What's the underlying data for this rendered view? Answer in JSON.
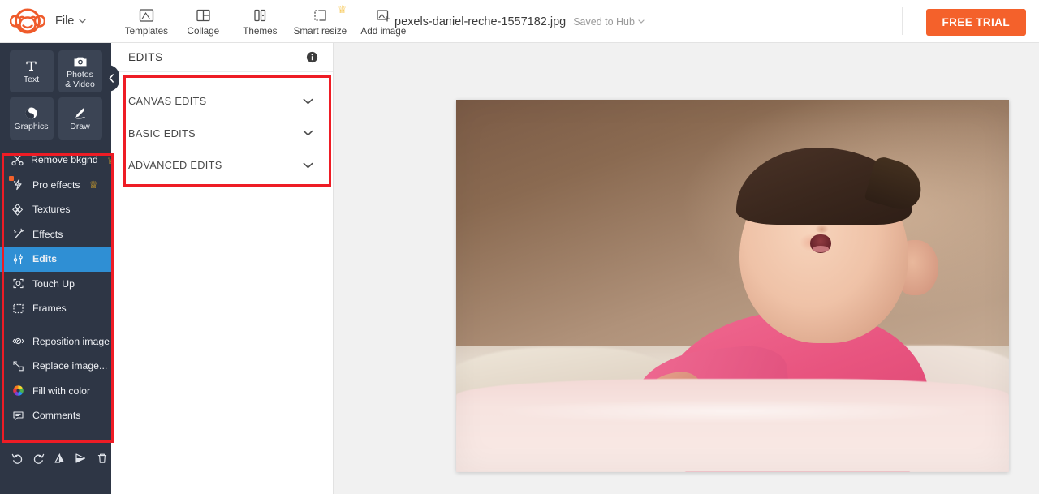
{
  "app": {
    "name": "PicMonkey",
    "logo_icon": "monkey-logo-icon",
    "accent_color": "#f4612b",
    "sidebar_color": "#2e3645",
    "highlight_color": "#2f8fd4",
    "annotation_color": "#ee1c25"
  },
  "topbar": {
    "file_menu": {
      "label": "File",
      "icon": "chevron-down-icon"
    },
    "tools": [
      {
        "label": "Templates",
        "icon": "templates-icon",
        "pro": false
      },
      {
        "label": "Collage",
        "icon": "collage-icon",
        "pro": false
      },
      {
        "label": "Themes",
        "icon": "themes-icon",
        "pro": false
      },
      {
        "label": "Smart resize",
        "icon": "smart-resize-icon",
        "pro": true,
        "pro_icon": "crown-icon"
      },
      {
        "label": "Add image",
        "icon": "add-image-icon",
        "pro": false
      }
    ],
    "document": {
      "title": "pexels-daniel-reche-1557182.jpg",
      "save_status": "Saved to Hub",
      "save_status_icon": "chevron-down-icon"
    },
    "free_trial_button": "FREE TRIAL"
  },
  "sidebar": {
    "quick_tools": [
      {
        "label": "Text",
        "icon": "text-t-icon"
      },
      {
        "label": "Photos\n& Video",
        "label_line1": "Photos",
        "label_line2": "& Video",
        "icon": "camera-icon"
      },
      {
        "label": "Graphics",
        "icon": "graphics-icon"
      },
      {
        "label": "Draw",
        "icon": "pencil-draw-icon"
      }
    ],
    "collapse_icon": "chevron-left-icon",
    "menu_group_1": [
      {
        "label": "Remove bkgnd",
        "icon": "scissors-icon",
        "pro": true,
        "badge": false,
        "active": false
      },
      {
        "label": "Pro effects",
        "icon": "lightning-effects-icon",
        "pro": true,
        "badge": true,
        "active": false
      },
      {
        "label": "Textures",
        "icon": "textures-icon",
        "pro": false,
        "badge": false,
        "active": false
      },
      {
        "label": "Effects",
        "icon": "magic-wand-icon",
        "pro": false,
        "badge": false,
        "active": false
      },
      {
        "label": "Edits",
        "icon": "sliders-icon",
        "pro": false,
        "badge": false,
        "active": true
      },
      {
        "label": "Touch Up",
        "icon": "touch-up-icon",
        "pro": false,
        "badge": false,
        "active": false
      },
      {
        "label": "Frames",
        "icon": "frames-icon",
        "pro": false,
        "badge": false,
        "active": false
      }
    ],
    "menu_group_2": [
      {
        "label": "Reposition image",
        "icon": "reposition-icon"
      },
      {
        "label": "Replace image...",
        "icon": "replace-image-icon"
      },
      {
        "label": "Fill with color",
        "icon": "color-wheel-icon"
      },
      {
        "label": "Comments",
        "icon": "comment-bubble-icon"
      }
    ],
    "bottom_tools": [
      {
        "name": "undo-button",
        "icon": "undo-icon"
      },
      {
        "name": "redo-button",
        "icon": "redo-icon"
      },
      {
        "name": "flip-vertical-button",
        "icon": "flip-vertical-icon"
      },
      {
        "name": "flip-horizontal-button",
        "icon": "flip-horizontal-icon"
      },
      {
        "name": "delete-button",
        "icon": "trash-icon"
      }
    ]
  },
  "panel": {
    "title": "EDITS",
    "info_icon": "info-icon",
    "accordions": [
      {
        "label": "CANVAS EDITS",
        "icon": "chevron-down-icon",
        "expanded": false
      },
      {
        "label": "BASIC EDITS",
        "icon": "chevron-down-icon",
        "expanded": false
      },
      {
        "label": "ADVANCED EDITS",
        "icon": "chevron-down-icon",
        "expanded": false
      }
    ]
  },
  "canvas": {
    "image_alt": "Smiling baby in pink outfit lying on a bed",
    "background_color": "#f1f1f1"
  }
}
